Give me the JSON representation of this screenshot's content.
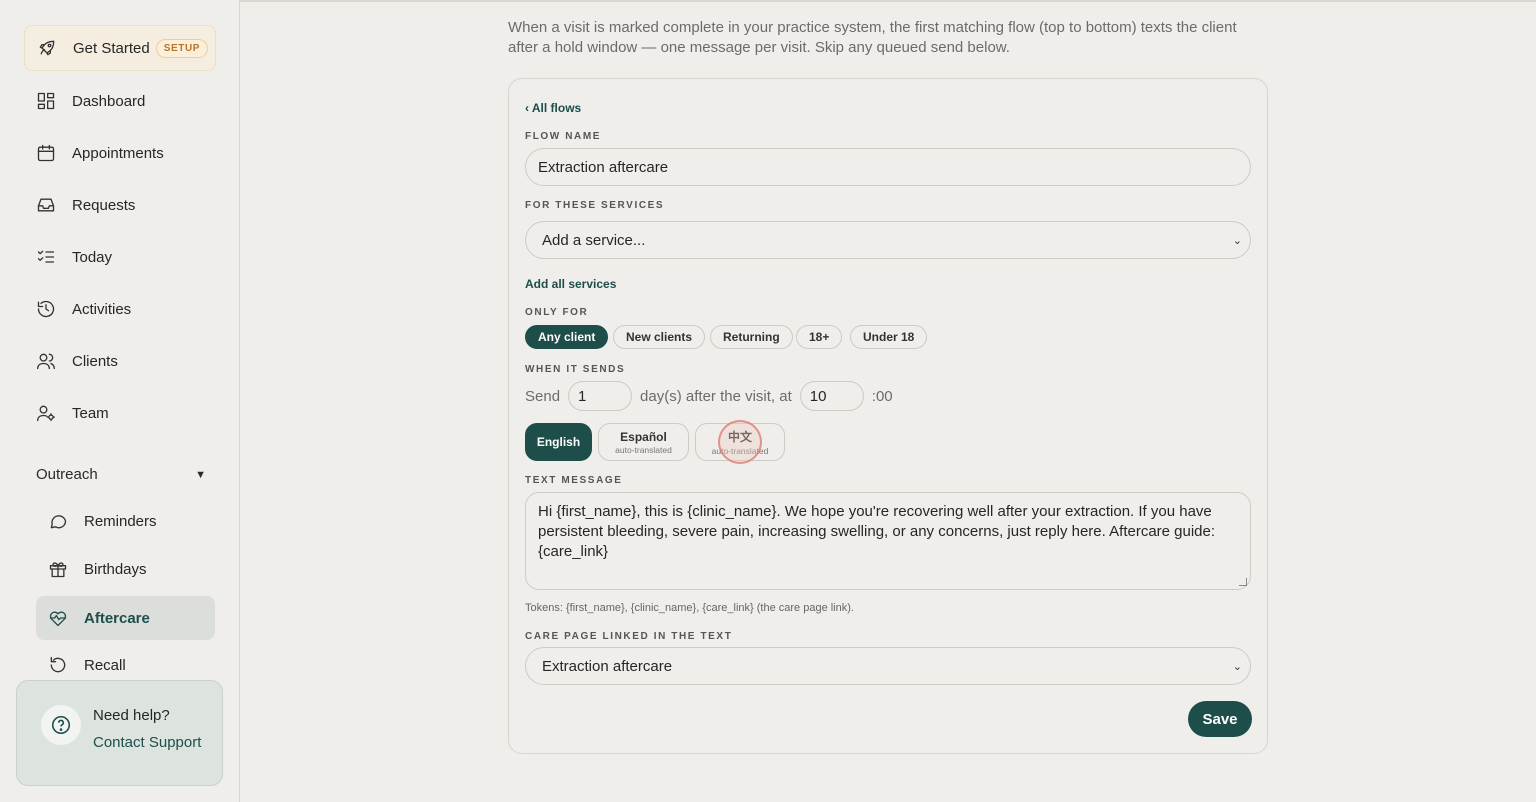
{
  "sidebar": {
    "get_started": {
      "label": "Get Started",
      "badge": "SETUP",
      "icon": "rocket-icon"
    },
    "items": [
      {
        "label": "Dashboard",
        "icon": "dashboard-icon"
      },
      {
        "label": "Appointments",
        "icon": "calendar-icon"
      },
      {
        "label": "Requests",
        "icon": "inbox-icon"
      },
      {
        "label": "Today",
        "icon": "checklist-icon"
      },
      {
        "label": "Activities",
        "icon": "history-icon"
      },
      {
        "label": "Clients",
        "icon": "users-icon"
      },
      {
        "label": "Team",
        "icon": "team-settings-icon"
      }
    ],
    "outreach": {
      "label": "Outreach",
      "caret": "▼",
      "items": [
        {
          "label": "Reminders",
          "icon": "chat-bubble-icon"
        },
        {
          "label": "Birthdays",
          "icon": "gift-icon"
        },
        {
          "label": "Aftercare",
          "icon": "heart-pulse-icon",
          "active": true
        },
        {
          "label": "Recall",
          "icon": "refresh-icon"
        }
      ]
    },
    "help": {
      "title": "Need help?",
      "link": "Contact Support",
      "icon": "question-circle-icon"
    }
  },
  "main": {
    "intro": "When a visit is marked complete in your practice system, the first matching flow (top to bottom) texts the client after a hold window — one message per visit. Skip any queued send below.",
    "back_link": "‹ All flows",
    "flow_name_label": "FLOW NAME",
    "flow_name_value": "Extraction aftercare",
    "services_label": "FOR THESE SERVICES",
    "services_placeholder": "Add a service...",
    "add_all_services": "Add all services",
    "only_for_label": "ONLY FOR",
    "audience_chips": [
      {
        "label": "Any client",
        "active": true
      },
      {
        "label": "New clients",
        "active": false
      },
      {
        "label": "Returning",
        "active": false
      },
      {
        "label": "18+",
        "active": false
      },
      {
        "label": "Under 18",
        "active": false
      }
    ],
    "when_label": "WHEN IT SENDS",
    "send_prefix": "Send",
    "days_value": "1",
    "days_suffix": "day(s) after the visit, at",
    "hour_value": "10",
    "minutes_suffix": ":00",
    "languages": [
      {
        "label": "English",
        "sub": "",
        "active": true
      },
      {
        "label": "Español",
        "sub": "auto-translated",
        "active": false
      },
      {
        "label": "中文",
        "sub": "auto-translated",
        "active": false
      }
    ],
    "text_message_label": "TEXT MESSAGE",
    "text_message_value": "Hi {first_name}, this is {clinic_name}. We hope you're recovering well after your extraction. If you have persistent bleeding, severe pain, increasing swelling, or any concerns, just reply here. Aftercare guide: {care_link}",
    "tokens_hint": "Tokens: {first_name}, {clinic_name}, {care_link} (the care page link).",
    "care_page_label": "CARE PAGE LINKED IN THE TEXT",
    "care_page_value": "Extraction aftercare",
    "save_label": "Save",
    "chevron": "⌄"
  },
  "colors": {
    "accent": "#1d4e4a",
    "background": "#efeeeb",
    "setup_badge": "#b8742a"
  }
}
